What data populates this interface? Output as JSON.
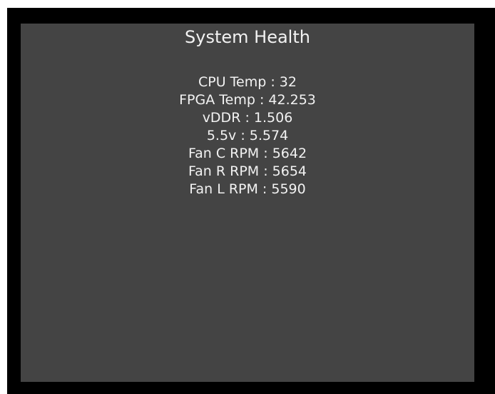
{
  "title": "System Health",
  "metrics": [
    {
      "label": "CPU Temp",
      "sep": " : ",
      "value": "32"
    },
    {
      "label": "FPGA Temp",
      "sep": " : ",
      "value": "42.253"
    },
    {
      "label": "vDDR",
      "sep": " : ",
      "value": "1.506"
    },
    {
      "label": "5.5v",
      "sep": " : ",
      "value": "5.574"
    },
    {
      "label": "Fan C RPM",
      "sep": " : ",
      "value": "5642"
    },
    {
      "label": "Fan R RPM",
      "sep": " : ",
      "value": "5654"
    },
    {
      "label": "Fan L RPM",
      "sep": " : ",
      "value": "5590"
    }
  ],
  "colors": {
    "bezel": "#000000",
    "screen_background": "#444444",
    "text": "#f2f2f2"
  }
}
